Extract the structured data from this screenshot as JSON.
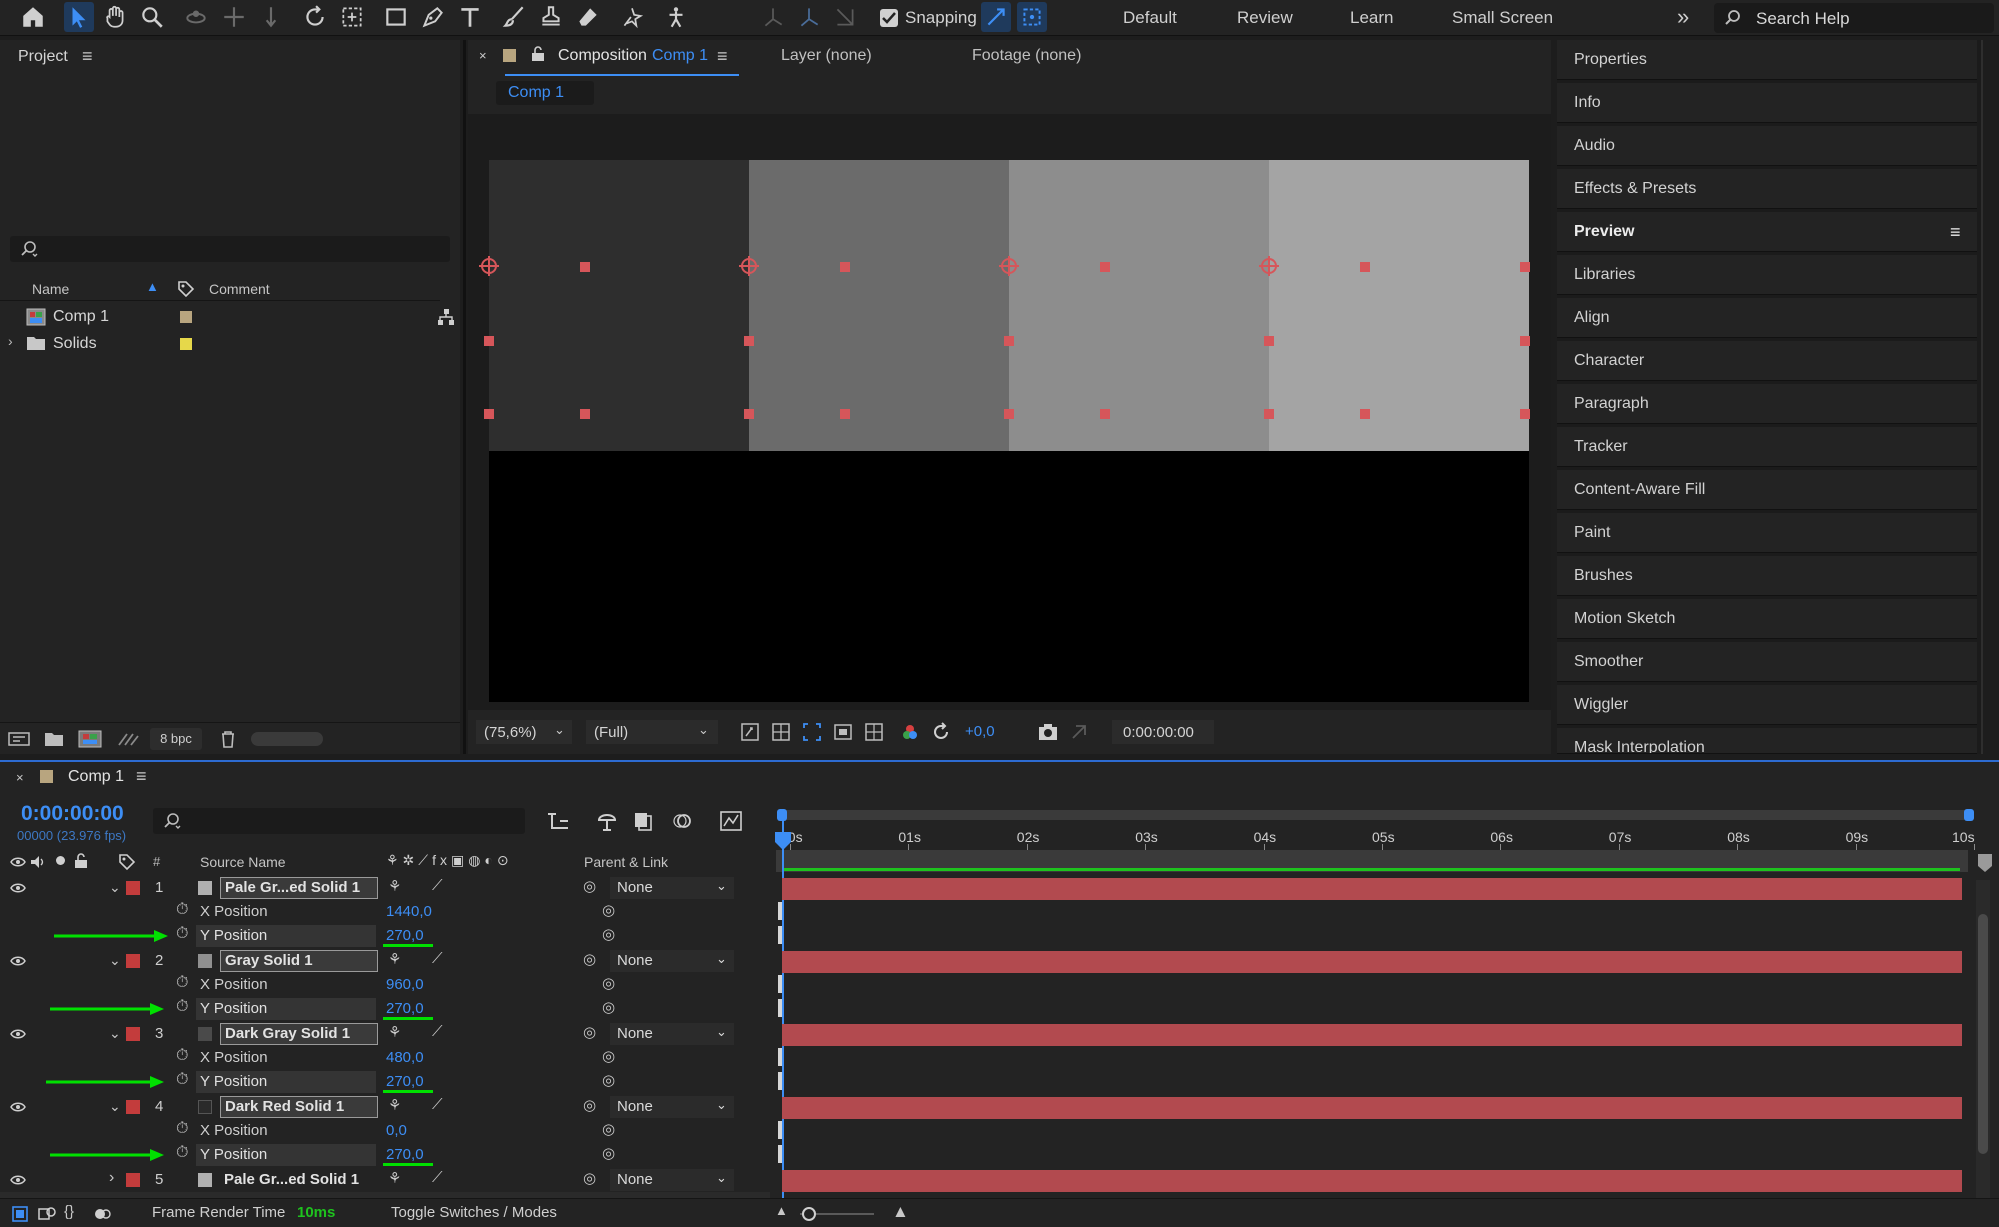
{
  "toolbar": {
    "snapping_label": "Snapping",
    "workspaces": [
      "Default",
      "Review",
      "Learn",
      "Small Screen"
    ],
    "search_placeholder": "Search Help"
  },
  "project": {
    "title": "Project",
    "columns": {
      "name": "Name",
      "comment": "Comment"
    },
    "items": [
      {
        "label": "Comp 1",
        "swatch": "#b8a57f"
      },
      {
        "label": "Solids",
        "swatch": "#e6d84a"
      }
    ],
    "bpc": "8 bpc"
  },
  "comp_panel": {
    "tab_prefix": "Composition",
    "tab_name": "Comp 1",
    "layer_tab": "Layer (none)",
    "footage_tab": "Footage (none)",
    "subtab": "Comp 1",
    "zoom": "(75,6%)",
    "resolution": "(Full)",
    "exposure": "+0,0",
    "timecode": "0:00:00:00"
  },
  "right_panel": {
    "items": [
      "Properties",
      "Info",
      "Audio",
      "Effects & Presets",
      "Preview",
      "Libraries",
      "Align",
      "Character",
      "Paragraph",
      "Tracker",
      "Content-Aware Fill",
      "Paint",
      "Brushes",
      "Motion Sketch",
      "Smoother",
      "Wiggler",
      "Mask Interpolation"
    ]
  },
  "timeline": {
    "tab": "Comp 1",
    "time": "0:00:00:00",
    "fps": "00000 (23.976 fps)",
    "col_source": "Source Name",
    "col_parent": "Parent & Link",
    "ruler": [
      "00s",
      "01s",
      "02s",
      "03s",
      "04s",
      "05s",
      "06s",
      "07s",
      "08s",
      "09s",
      "10s"
    ],
    "layers": [
      {
        "num": "1",
        "name": "Pale Gr...ed Solid 1",
        "parent": "None",
        "x": "1440,0",
        "y": "270,0"
      },
      {
        "num": "2",
        "name": "Gray Solid 1",
        "parent": "None",
        "x": "960,0",
        "y": "270,0"
      },
      {
        "num": "3",
        "name": "Dark Gray Solid 1",
        "parent": "None",
        "x": "480,0",
        "y": "270,0"
      },
      {
        "num": "4",
        "name": "Dark Red Solid 1",
        "parent": "None",
        "x": "0,0",
        "y": "270,0"
      },
      {
        "num": "5",
        "name": "Pale Gr...ed Solid 1",
        "parent": "None"
      }
    ],
    "x_label": "X Position",
    "y_label": "Y Position",
    "render_label": "Frame Render Time",
    "render_value": "10ms",
    "toggle_label": "Toggle Switches / Modes"
  },
  "colors": {
    "accent": "#3d8ef5",
    "layer_bar": "#b24a4f",
    "label_red": "#c33c3c",
    "annotation": "#00e000"
  }
}
